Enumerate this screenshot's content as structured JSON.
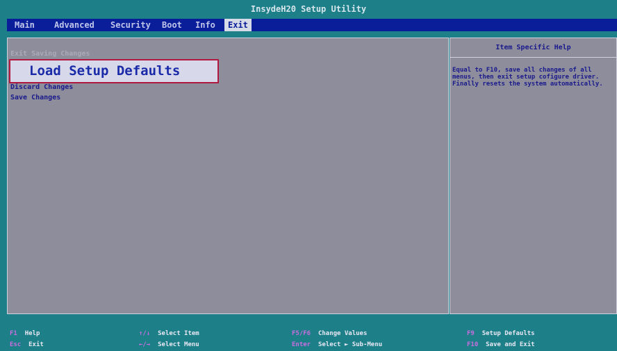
{
  "title": "InsydeH20 Setup Utility",
  "menu": {
    "tabs": [
      "Main",
      "Advanced",
      "Security",
      "Boot",
      "Info",
      "Exit"
    ],
    "active": "Exit"
  },
  "exit_menu": {
    "items": [
      "Exit Saving Changes",
      "Load Setup Defaults",
      "Discard Changes",
      "Save Changes"
    ],
    "selected": "Load Setup Defaults"
  },
  "help": {
    "title": "Item Specific Help",
    "text": "Equal to F10, save all changes of all\nmenus, then exit setup cofigure driver.\nFinally resets the system automatically."
  },
  "footer": [
    {
      "key": "F1",
      "desc": "Help"
    },
    {
      "key": "Esc",
      "desc": "Exit"
    },
    {
      "key": "↑/↓",
      "desc": "Select Item"
    },
    {
      "key": "←/→",
      "desc": "Select Menu"
    },
    {
      "key": "F5/F6",
      "desc": "Change Values"
    },
    {
      "key": "Enter",
      "desc": "Select ► Sub-Menu"
    },
    {
      "key": "F9",
      "desc": "Setup Defaults"
    },
    {
      "key": "F10",
      "desc": "Save and Exit"
    }
  ]
}
